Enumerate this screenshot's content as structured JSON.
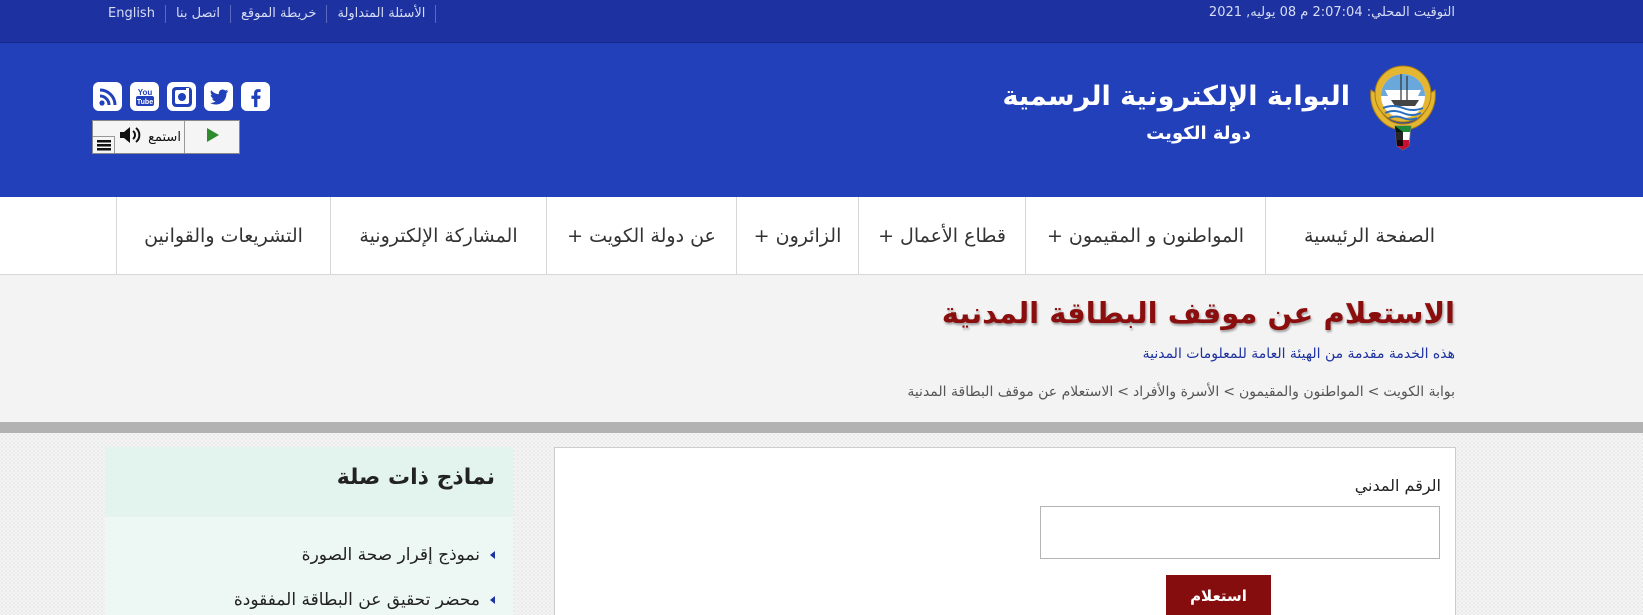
{
  "topbar": {
    "clock": "التوقيت المحلي: 2:07:04 م 08 يوليه, 2021",
    "links": [
      {
        "label": "الأسئلة المتداولة"
      },
      {
        "label": "خريطة الموقع"
      },
      {
        "label": "اتصل بنا"
      },
      {
        "label": "English"
      }
    ]
  },
  "header": {
    "title": "البوابة الإلكترونية الرسمية",
    "subtitle": "دولة  الكويت",
    "social_icons": [
      "rss-icon",
      "youtube-icon",
      "instagram-icon",
      "twitter-icon",
      "facebook-icon"
    ],
    "listen": {
      "label": "استمع",
      "speaker_icon": "speaker-icon",
      "play_icon": "play-icon",
      "menu_icon": "menu-icon"
    },
    "colors": {
      "brand_blue": "#2340bb",
      "topbar_blue": "#1d32a0"
    }
  },
  "nav": {
    "items": [
      {
        "label": "الصفحة الرئيسية"
      },
      {
        "label": "المواطنون و المقيمون +"
      },
      {
        "label": "قطاع الأعمال +"
      },
      {
        "label": "الزائرون +"
      },
      {
        "label": "عن دولة الكويت +"
      },
      {
        "label": "المشاركة الإلكترونية"
      },
      {
        "label": "التشريعات والقوانين"
      }
    ]
  },
  "page": {
    "title": "الاستعلام عن موقف البطاقة المدنية",
    "provider": "هذه الخدمة مقدمة من الهيئة العامة للمعلومات المدنية",
    "breadcrumb": [
      {
        "label": "بوابة الكويت"
      },
      {
        "label": "المواطنون والمقيمون"
      },
      {
        "label": "الأسرة والأفراد"
      },
      {
        "label": "الاستعلام عن موقف البطاقة المدنية"
      }
    ],
    "breadcrumb_separator": ">",
    "title_color": "#8b0e0e"
  },
  "form": {
    "civil_id_label": "الرقم المدني",
    "civil_id_value": "",
    "submit_label": "استعلام",
    "submit_color": "#860d0d"
  },
  "related": {
    "title": "نماذج ذات صلة",
    "items": [
      {
        "label": "نموذج إقرار صحة الصورة"
      },
      {
        "label": "محضر تحقيق عن البطاقة المفقودة"
      }
    ]
  }
}
